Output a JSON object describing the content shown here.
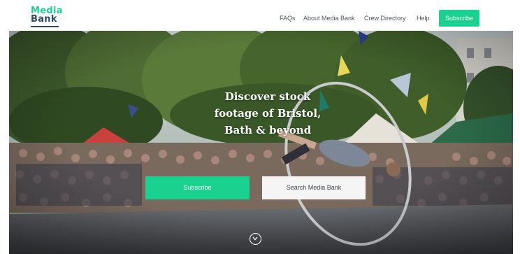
{
  "brand": {
    "logo_line1": "Media",
    "logo_line2": "Bank",
    "accent_color": "#1ad18f",
    "dark_color": "#2f4a5e"
  },
  "nav": {
    "items": [
      {
        "label": "FAQs"
      },
      {
        "label": "About Media Bank"
      },
      {
        "label": "Crew Directory"
      },
      {
        "label": "Help"
      }
    ],
    "subscribe_label": "Subscribe"
  },
  "hero": {
    "title_lines": [
      "Discover stock",
      "footage of Bristol,",
      "Bath & beyond"
    ],
    "primary_button": "Subscribe",
    "secondary_button": "Search Media Bank",
    "scroll_icon": "chevron-down-circle-icon"
  }
}
